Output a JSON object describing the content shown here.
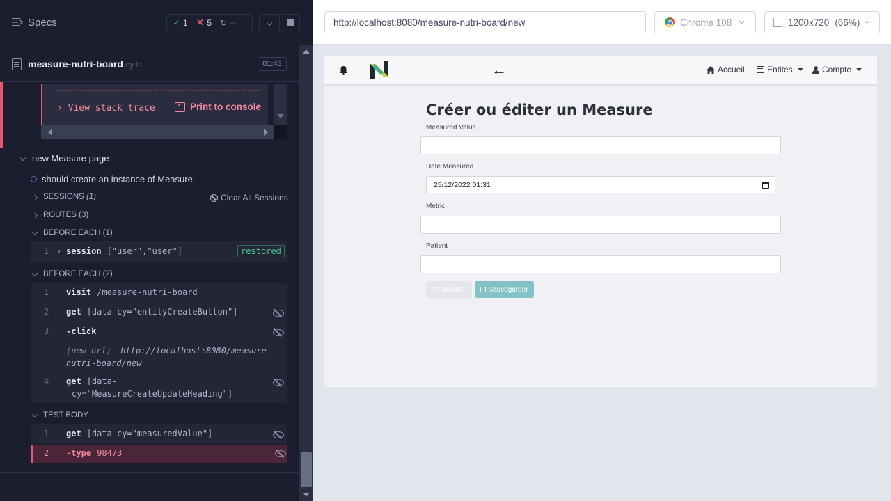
{
  "runner": {
    "specs_title": "Specs",
    "stats": {
      "passed": "1",
      "failed": "5",
      "pending": "--"
    },
    "spec": {
      "name": "measure-nutri-board",
      "ext": ".cy.ts",
      "duration": "01:43"
    },
    "error": {
      "stack_trace_label": "View stack trace",
      "print_label": "Print to console"
    },
    "suite": {
      "title": "new Measure page"
    },
    "test": {
      "title": "should create an instance of Measure"
    },
    "sections": {
      "sessions": {
        "label": "SESSIONS",
        "count": "(1)"
      },
      "clear_sessions": "Clear All Sessions",
      "routes": {
        "label": "ROUTES",
        "count": "(3)"
      },
      "before_each_1": "BEFORE EACH (1)",
      "before_each_2": "BEFORE EACH (2)",
      "test_body": "TEST BODY"
    },
    "before_each_1_cmds": [
      {
        "num": "1",
        "name": "session",
        "arg": "[\"user\",\"user\"]",
        "badge": "restored"
      }
    ],
    "before_each_2_cmds": [
      {
        "num": "1",
        "name": "visit",
        "arg": "/measure-nutri-board"
      },
      {
        "num": "2",
        "name": "get",
        "arg": "[data-cy=\"entityCreateButton\"]"
      },
      {
        "num": "3",
        "name": "-click",
        "arg": ""
      },
      {
        "num": "4",
        "name": "get",
        "arg": "[data-",
        "arg2": "cy=\"MeasureCreateUpdateHeading\"]"
      }
    ],
    "url_log": {
      "key": "(new url)",
      "value": "http://localhost:8080/measure-",
      "value2": "nutri-board/new"
    },
    "test_body_cmds": [
      {
        "num": "1",
        "name": "get",
        "arg": "[data-cy=\"measuredValue\"]"
      },
      {
        "num": "2",
        "name": "-type",
        "arg": "98473"
      }
    ]
  },
  "browser": {
    "url": "http://localhost:8080/measure-nutri-board/new",
    "browser_name": "Chrome 108",
    "viewport": "1200x720",
    "zoom": "(66%)"
  },
  "app": {
    "nav": {
      "home": "Accueil",
      "entities": "Entités",
      "account": "Compte"
    },
    "form": {
      "title": "Créer ou éditer un Measure",
      "fields": {
        "measured_value": {
          "label": "Measured Value",
          "value": ""
        },
        "date_measured": {
          "label": "Date Measured",
          "value": "25/12/2022 01:31"
        },
        "metric": {
          "label": "Metric",
          "value": ""
        },
        "patient": {
          "label": "Patient",
          "value": ""
        }
      },
      "cancel_label": "Annuler",
      "save_label": "Sauvegarder"
    }
  },
  "colors": {
    "runner_bg": "#1b1e2e",
    "fail": "#e55970",
    "pass": "#1fa971",
    "save_btn": "#83c3c7"
  }
}
